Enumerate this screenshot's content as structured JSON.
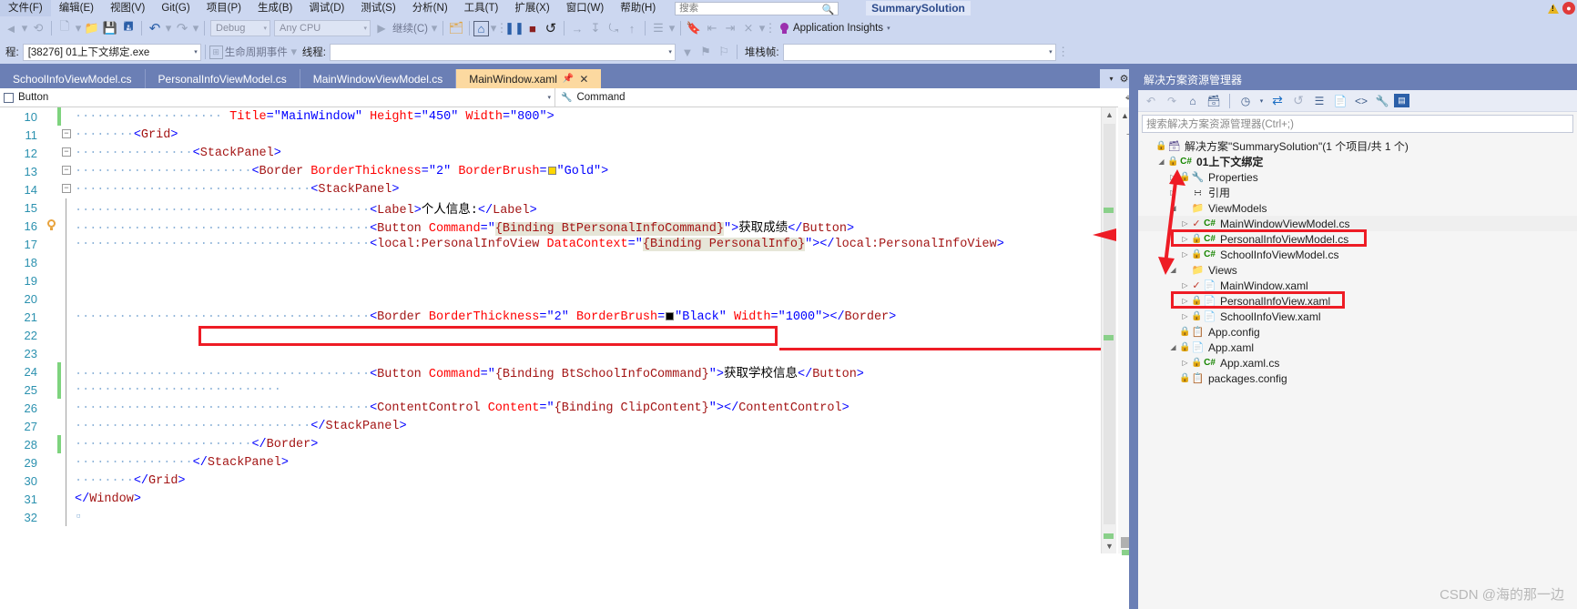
{
  "menubar": {
    "items": [
      {
        "label": "文件(F)"
      },
      {
        "label": "编辑(E)"
      },
      {
        "label": "视图(V)"
      },
      {
        "label": "Git(G)"
      },
      {
        "label": "项目(P)"
      },
      {
        "label": "生成(B)"
      },
      {
        "label": "调试(D)"
      },
      {
        "label": "测试(S)"
      },
      {
        "label": "分析(N)"
      },
      {
        "label": "工具(T)"
      },
      {
        "label": "扩展(X)"
      },
      {
        "label": "窗口(W)"
      },
      {
        "label": "帮助(H)"
      }
    ],
    "search_placeholder": "搜索",
    "search_value": "",
    "solution_title": "SummarySolution",
    "warning_icon": "warning-triangle-icon",
    "notification_icon": "notification-bell-icon"
  },
  "toolbar1": {
    "back_icon": "navigate-back-icon",
    "forward_icon": "navigate-forward-icon",
    "new_item_icon": "new-item-icon",
    "open_icon": "open-folder-icon",
    "save_icon": "save-icon",
    "save_all_icon": "save-all-icon",
    "undo_icon": "undo-icon",
    "redo_icon": "redo-icon",
    "config_value": "Debug",
    "platform_value": "Any CPU",
    "continue_label": "继续(C)",
    "attach_icon": "attach-process-icon",
    "hotreload_icon": "hot-reload-icon",
    "pause_icon": "pause-icon",
    "stop_icon": "stop-icon",
    "restart_icon": "restart-icon",
    "stepover_icon": "step-over-icon",
    "stepinto_icon": "step-into-icon",
    "stepout_icon": "step-out-icon",
    "stepup_icon": "step-up-icon",
    "threads_icon": "threads-icon",
    "bookmark_icon": "bookmark-icon",
    "bookmark_prev_icon": "bookmark-prev-icon",
    "bookmark_next_icon": "bookmark-next-icon",
    "bookmark_clear_icon": "bookmark-clear-icon",
    "app_insights_label": "Application Insights",
    "bulb_icon": "lightbulb-icon",
    "caret_icon": "chevron-down-icon"
  },
  "toolbar2": {
    "process_label": "程:",
    "process_value": "[38276] 01上下文绑定.exe",
    "lifecycle_icon": "lifecycle-events-icon",
    "lifecycle_label": "生命周期事件",
    "thread_label": "线程:",
    "thread_value": "",
    "stack_label": "堆栈帧:",
    "stack_value": "",
    "filter_icon": "filter-icon",
    "caret_icon": "chevron-down-icon"
  },
  "tabs": [
    {
      "label": "SchoolInfoViewModel.cs",
      "active": false
    },
    {
      "label": "PersonalInfoViewModel.cs",
      "active": false
    },
    {
      "label": "MainWindowViewModel.cs",
      "active": false
    },
    {
      "label": "MainWindow.xaml",
      "active": true,
      "pin_icon": "pin-icon",
      "close_icon": "close-icon"
    }
  ],
  "navbar": {
    "left_icon": "element-icon",
    "left_value": "Button",
    "right_icon": "wrench-icon",
    "right_value": "Command",
    "caret_icon": "chevron-down-icon"
  },
  "editor": {
    "lines": [
      {
        "no": "10",
        "fold": "",
        "change": "green",
        "indent_dots": 10,
        "tokens": [
          {
            "t": " Title",
            "c": "attr"
          },
          {
            "t": "=",
            "c": "punc"
          },
          {
            "t": "\"MainWindow\"",
            "c": "val"
          },
          {
            "t": " ",
            "c": "text"
          },
          {
            "t": "Height",
            "c": "attr"
          },
          {
            "t": "=",
            "c": "punc"
          },
          {
            "t": "\"450\"",
            "c": "val"
          },
          {
            "t": " ",
            "c": "text"
          },
          {
            "t": "Width",
            "c": "attr"
          },
          {
            "t": "=",
            "c": "punc"
          },
          {
            "t": "\"800\"",
            "c": "val"
          },
          {
            "t": ">",
            "c": "punc"
          }
        ]
      },
      {
        "no": "11",
        "fold": "-",
        "indent_dots": 4,
        "tokens": [
          {
            "t": "<",
            "c": "punc"
          },
          {
            "t": "Grid",
            "c": "tag"
          },
          {
            "t": ">",
            "c": "punc"
          }
        ]
      },
      {
        "no": "12",
        "fold": "-",
        "indent_dots": 8,
        "tokens": [
          {
            "t": "<",
            "c": "punc"
          },
          {
            "t": "StackPanel",
            "c": "tag"
          },
          {
            "t": ">",
            "c": "punc"
          }
        ]
      },
      {
        "no": "13",
        "fold": "-",
        "indent_dots": 12,
        "tokens": [
          {
            "t": "<",
            "c": "punc"
          },
          {
            "t": "Border",
            "c": "tag"
          },
          {
            "t": " BorderThickness",
            "c": "attr"
          },
          {
            "t": "=",
            "c": "punc"
          },
          {
            "t": "\"2\"",
            "c": "val"
          },
          {
            "t": " ",
            "c": "text"
          },
          {
            "t": "BorderBrush",
            "c": "attr"
          },
          {
            "t": "=",
            "c": "punc"
          },
          {
            "t": "SWATCH_GOLD",
            "c": "swatch-gold"
          },
          {
            "t": "\"Gold\"",
            "c": "val"
          },
          {
            "t": ">",
            "c": "punc"
          }
        ]
      },
      {
        "no": "14",
        "fold": "-",
        "indent_dots": 16,
        "tokens": [
          {
            "t": "<",
            "c": "punc"
          },
          {
            "t": "StackPanel",
            "c": "tag"
          },
          {
            "t": ">",
            "c": "punc"
          }
        ]
      },
      {
        "no": "15",
        "fold": "",
        "indent_dots": 20,
        "tokens": [
          {
            "t": "<",
            "c": "punc"
          },
          {
            "t": "Label",
            "c": "tag"
          },
          {
            "t": ">",
            "c": "punc"
          },
          {
            "t": "个人信息:",
            "c": "text"
          },
          {
            "t": "</",
            "c": "punc"
          },
          {
            "t": "Label",
            "c": "tag"
          },
          {
            "t": ">",
            "c": "punc"
          }
        ]
      },
      {
        "no": "16",
        "fold": "",
        "bulb": true,
        "indent_dots": 20,
        "tokens": [
          {
            "t": "<",
            "c": "punc"
          },
          {
            "t": "Button",
            "c": "tag"
          },
          {
            "t": " Command",
            "c": "attr"
          },
          {
            "t": "=",
            "c": "punc"
          },
          {
            "t": "\"",
            "c": "val"
          },
          {
            "t": "{Binding BtPersonalInfoCommand}",
            "c": "bindhl"
          },
          {
            "t": "\"",
            "c": "val"
          },
          {
            "t": ">",
            "c": "punc"
          },
          {
            "t": "获取成绩",
            "c": "text"
          },
          {
            "t": "</",
            "c": "punc"
          },
          {
            "t": "Button",
            "c": "tag"
          },
          {
            "t": ">",
            "c": "punc"
          }
        ]
      },
      {
        "no": "17",
        "fold": "",
        "indent_dots": 20,
        "boxed": true,
        "tokens": [
          {
            "t": "<",
            "c": "punc"
          },
          {
            "t": "local:PersonalInfoView",
            "c": "tag"
          },
          {
            "t": " DataContext",
            "c": "attr"
          },
          {
            "t": "=",
            "c": "punc"
          },
          {
            "t": "\"",
            "c": "val"
          },
          {
            "t": "{Binding PersonalInfo}",
            "c": "bindhl"
          },
          {
            "t": "\"",
            "c": "val"
          },
          {
            "t": ">",
            "c": "punc"
          },
          {
            "t": "</",
            "c": "punc"
          },
          {
            "t": "local:PersonalInfoView",
            "c": "tag"
          },
          {
            "t": ">",
            "c": "punc"
          }
        ]
      },
      {
        "no": "18",
        "fold": "",
        "indent_dots": 0,
        "tokens": []
      },
      {
        "no": "19",
        "fold": "",
        "indent_dots": 0,
        "tokens": []
      },
      {
        "no": "20",
        "fold": "",
        "indent_dots": 0,
        "tokens": []
      },
      {
        "no": "21",
        "fold": "",
        "indent_dots": 20,
        "tokens": [
          {
            "t": "<",
            "c": "punc"
          },
          {
            "t": "Border",
            "c": "tag"
          },
          {
            "t": " BorderThickness",
            "c": "attr"
          },
          {
            "t": "=",
            "c": "punc"
          },
          {
            "t": "\"2\"",
            "c": "val"
          },
          {
            "t": " ",
            "c": "text"
          },
          {
            "t": "BorderBrush",
            "c": "attr"
          },
          {
            "t": "=",
            "c": "punc"
          },
          {
            "t": "SWATCH_BLACK",
            "c": "swatch-black"
          },
          {
            "t": "\"Black\"",
            "c": "val"
          },
          {
            "t": " ",
            "c": "text"
          },
          {
            "t": "Width",
            "c": "attr"
          },
          {
            "t": "=",
            "c": "punc"
          },
          {
            "t": "\"1000\"",
            "c": "val"
          },
          {
            "t": ">",
            "c": "punc"
          },
          {
            "t": "</",
            "c": "punc"
          },
          {
            "t": "Border",
            "c": "tag"
          },
          {
            "t": ">",
            "c": "punc"
          }
        ]
      },
      {
        "no": "22",
        "fold": "",
        "indent_dots": 0,
        "tokens": []
      },
      {
        "no": "23",
        "fold": "",
        "indent_dots": 0,
        "tokens": []
      },
      {
        "no": "24",
        "fold": "",
        "change": "green",
        "indent_dots": 20,
        "tokens": [
          {
            "t": "<",
            "c": "punc"
          },
          {
            "t": "Button",
            "c": "tag"
          },
          {
            "t": " Command",
            "c": "attr"
          },
          {
            "t": "=",
            "c": "punc"
          },
          {
            "t": "\"",
            "c": "val"
          },
          {
            "t": "{Binding BtSchoolInfoCommand}",
            "c": "bind"
          },
          {
            "t": "\"",
            "c": "val"
          },
          {
            "t": ">",
            "c": "punc"
          },
          {
            "t": "获取学校信息",
            "c": "text"
          },
          {
            "t": "</",
            "c": "punc"
          },
          {
            "t": "Button",
            "c": "tag"
          },
          {
            "t": ">",
            "c": "punc"
          }
        ]
      },
      {
        "no": "25",
        "fold": "",
        "change": "green",
        "indent_dots": 14,
        "tokens": []
      },
      {
        "no": "26",
        "fold": "",
        "indent_dots": 20,
        "tokens": [
          {
            "t": "<",
            "c": "punc"
          },
          {
            "t": "ContentControl",
            "c": "tag"
          },
          {
            "t": " Content",
            "c": "attr"
          },
          {
            "t": "=",
            "c": "punc"
          },
          {
            "t": "\"",
            "c": "val"
          },
          {
            "t": "{Binding ClipContent}",
            "c": "bind"
          },
          {
            "t": "\"",
            "c": "val"
          },
          {
            "t": ">",
            "c": "punc"
          },
          {
            "t": "</",
            "c": "punc"
          },
          {
            "t": "ContentControl",
            "c": "tag"
          },
          {
            "t": ">",
            "c": "punc"
          }
        ]
      },
      {
        "no": "27",
        "fold": "",
        "indent_dots": 16,
        "tokens": [
          {
            "t": "</",
            "c": "punc"
          },
          {
            "t": "StackPanel",
            "c": "tag"
          },
          {
            "t": ">",
            "c": "punc"
          }
        ]
      },
      {
        "no": "28",
        "fold": "",
        "change": "green",
        "indent_dots": 12,
        "tokens": [
          {
            "t": "</",
            "c": "punc"
          },
          {
            "t": "Border",
            "c": "tag"
          },
          {
            "t": ">",
            "c": "punc"
          }
        ]
      },
      {
        "no": "29",
        "fold": "",
        "indent_dots": 8,
        "tokens": [
          {
            "t": "</",
            "c": "punc"
          },
          {
            "t": "StackPanel",
            "c": "tag"
          },
          {
            "t": ">",
            "c": "punc"
          }
        ]
      },
      {
        "no": "30",
        "fold": "",
        "indent_dots": 4,
        "tokens": [
          {
            "t": "</",
            "c": "punc"
          },
          {
            "t": "Grid",
            "c": "tag"
          },
          {
            "t": ">",
            "c": "punc"
          }
        ]
      },
      {
        "no": "31",
        "fold": "",
        "indent_dots": 0,
        "tokens": [
          {
            "t": "</",
            "c": "punc"
          },
          {
            "t": "Window",
            "c": "tag"
          },
          {
            "t": ">",
            "c": "punc"
          }
        ]
      },
      {
        "no": "32",
        "fold": "",
        "indent_dots": 0,
        "tokens": [
          {
            "t": "▫",
            "c": "dot"
          }
        ]
      }
    ]
  },
  "solution_explorer": {
    "title": "解决方案资源管理器",
    "toolbar": {
      "back_icon": "nav-back-icon",
      "forward_icon": "nav-forward-icon",
      "home_icon": "home-icon",
      "sync_icon": "sync-with-active-doc-icon",
      "pending_icon": "pending-changes-icon",
      "refresh_icon": "refresh-icon",
      "collapse_icon": "collapse-all-icon",
      "show_all_icon": "show-all-files-icon",
      "properties_icon": "properties-icon",
      "code_view_icon": "view-code-icon",
      "prop_window_icon": "properties-window-icon",
      "preview_icon": "preview-selected-icon"
    },
    "search_placeholder": "搜索解决方案资源管理器(Ctrl+;)",
    "search_value": "",
    "tree": [
      {
        "depth": 0,
        "tw": "",
        "lock": true,
        "icon": "solution-icon",
        "icon_class": "ic-sol",
        "label": "解决方案\"SummarySolution\"(1 个项目/共 1 个)",
        "bold": false
      },
      {
        "depth": 1,
        "tw": "open",
        "lock": true,
        "icon": "csharp-project-icon",
        "icon_class": "ic-cs",
        "label": "01上下文绑定",
        "bold": true
      },
      {
        "depth": 2,
        "tw": "closed",
        "lock": true,
        "icon": "wrench-icon",
        "icon_class": "ic-wrench",
        "label": "Properties",
        "bold": false
      },
      {
        "depth": 2,
        "tw": "closed",
        "lock": false,
        "icon": "references-icon",
        "icon_class": "ic-ref",
        "label": "引用",
        "bold": false
      },
      {
        "depth": 2,
        "tw": "open",
        "lock": false,
        "icon": "folder-icon",
        "icon_class": "ic-folder",
        "label": "ViewModels",
        "bold": false
      },
      {
        "depth": 3,
        "tw": "closed",
        "check": true,
        "icon": "csharp-file-icon",
        "icon_class": "ic-cs",
        "label": "MainWindowViewModel.cs",
        "bold": false,
        "selected": true
      },
      {
        "depth": 3,
        "tw": "closed",
        "lock": true,
        "icon": "csharp-file-icon",
        "icon_class": "ic-cs",
        "label": "PersonalInfoViewModel.cs",
        "bold": false,
        "boxed": true
      },
      {
        "depth": 3,
        "tw": "closed",
        "lock": true,
        "icon": "csharp-file-icon",
        "icon_class": "ic-cs",
        "label": "SchoolInfoViewModel.cs",
        "bold": false
      },
      {
        "depth": 2,
        "tw": "open",
        "lock": false,
        "icon": "folder-icon",
        "icon_class": "ic-folder",
        "label": "Views",
        "bold": false
      },
      {
        "depth": 3,
        "tw": "closed",
        "check": true,
        "icon": "xaml-file-icon",
        "icon_class": "ic-xaml",
        "label": "MainWindow.xaml",
        "bold": false
      },
      {
        "depth": 3,
        "tw": "closed",
        "lock": true,
        "icon": "xaml-file-icon",
        "icon_class": "ic-xaml",
        "label": "PersonalInfoView.xaml",
        "bold": false,
        "boxed": true
      },
      {
        "depth": 3,
        "tw": "closed",
        "lock": true,
        "icon": "xaml-file-icon",
        "icon_class": "ic-xaml",
        "label": "SchoolInfoView.xaml",
        "bold": false
      },
      {
        "depth": 2,
        "tw": "",
        "lock": true,
        "icon": "config-file-icon",
        "icon_class": "ic-cfg",
        "label": "App.config",
        "bold": false
      },
      {
        "depth": 2,
        "tw": "open",
        "lock": true,
        "icon": "xaml-file-icon",
        "icon_class": "ic-xaml",
        "label": "App.xaml",
        "bold": false
      },
      {
        "depth": 3,
        "tw": "closed",
        "lock": true,
        "icon": "csharp-file-icon",
        "icon_class": "ic-cs",
        "label": "App.xaml.cs",
        "bold": false
      },
      {
        "depth": 2,
        "tw": "",
        "lock": true,
        "icon": "config-file-icon",
        "icon_class": "ic-cfg",
        "label": "packages.config",
        "bold": false
      }
    ]
  },
  "watermark": "CSDN @海的那一边",
  "colors": {
    "chrome": "#ccd7f0",
    "tabstrip": "#6b7fb5",
    "active_tab": "#fcd9a0",
    "annotation_red": "#ee1c25",
    "lineno": "#2b91af",
    "tag": "#a31515",
    "attr": "#ff0000",
    "value": "#0000ff"
  }
}
